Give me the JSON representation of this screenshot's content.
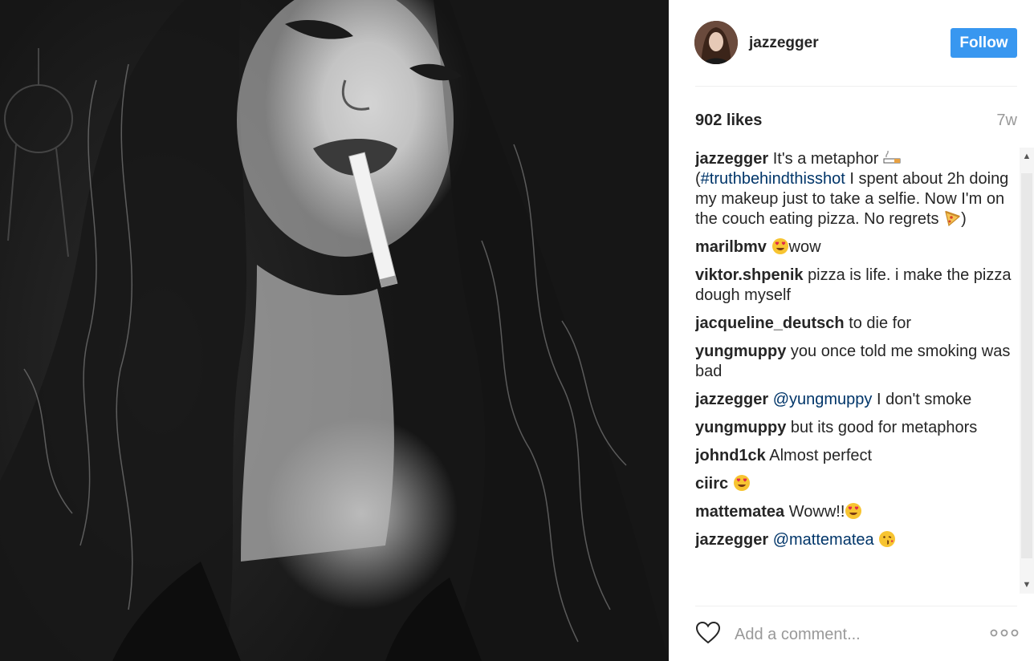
{
  "post": {
    "photo_alt": "black and white selfie with cigarette",
    "author": "jazzegger",
    "follow_label": "Follow",
    "likes": "902 likes",
    "time": "7w"
  },
  "comments": [
    {
      "user": "jazzegger",
      "parts": [
        {
          "t": "It's a metaphor "
        },
        {
          "emoji": "cigarette"
        },
        {
          "t": " ("
        },
        {
          "link": "#truthbehindthisshot"
        },
        {
          "t": " I spent about 2h doing my makeup just to take a selfie. Now I'm on the couch eating pizza. No regrets "
        },
        {
          "emoji": "pizza"
        },
        {
          "t": ")"
        }
      ]
    },
    {
      "user": "marilbmv",
      "parts": [
        {
          "emoji": "heart-eyes"
        },
        {
          "t": "wow"
        }
      ]
    },
    {
      "user": "viktor.shpenik",
      "parts": [
        {
          "t": "pizza is life. i make the pizza dough myself"
        }
      ]
    },
    {
      "user": "jacqueline_deutsch",
      "parts": [
        {
          "t": "to die for"
        }
      ]
    },
    {
      "user": "yungmuppy",
      "parts": [
        {
          "t": "you once told me smoking was bad"
        }
      ]
    },
    {
      "user": "jazzegger",
      "parts": [
        {
          "link": "@yungmuppy"
        },
        {
          "t": " I don't smoke"
        }
      ]
    },
    {
      "user": "yungmuppy",
      "parts": [
        {
          "t": "but its good for metaphors"
        }
      ]
    },
    {
      "user": "johnd1ck",
      "parts": [
        {
          "t": "Almost perfect"
        }
      ]
    },
    {
      "user": "ciirc",
      "parts": [
        {
          "emoji": "heart-eyes"
        }
      ]
    },
    {
      "user": "mattematea",
      "parts": [
        {
          "t": "Woww!!"
        },
        {
          "emoji": "heart-eyes"
        }
      ]
    },
    {
      "user": "jazzegger",
      "parts": [
        {
          "link": "@mattematea"
        },
        {
          "t": " "
        },
        {
          "emoji": "kiss"
        }
      ]
    }
  ],
  "composer": {
    "placeholder": "Add a comment...",
    "heart_icon": "heart-outline-icon",
    "more_icon": "more-options-icon"
  },
  "colors": {
    "accent": "#3897f0",
    "link": "#003569",
    "muted": "#999999"
  }
}
